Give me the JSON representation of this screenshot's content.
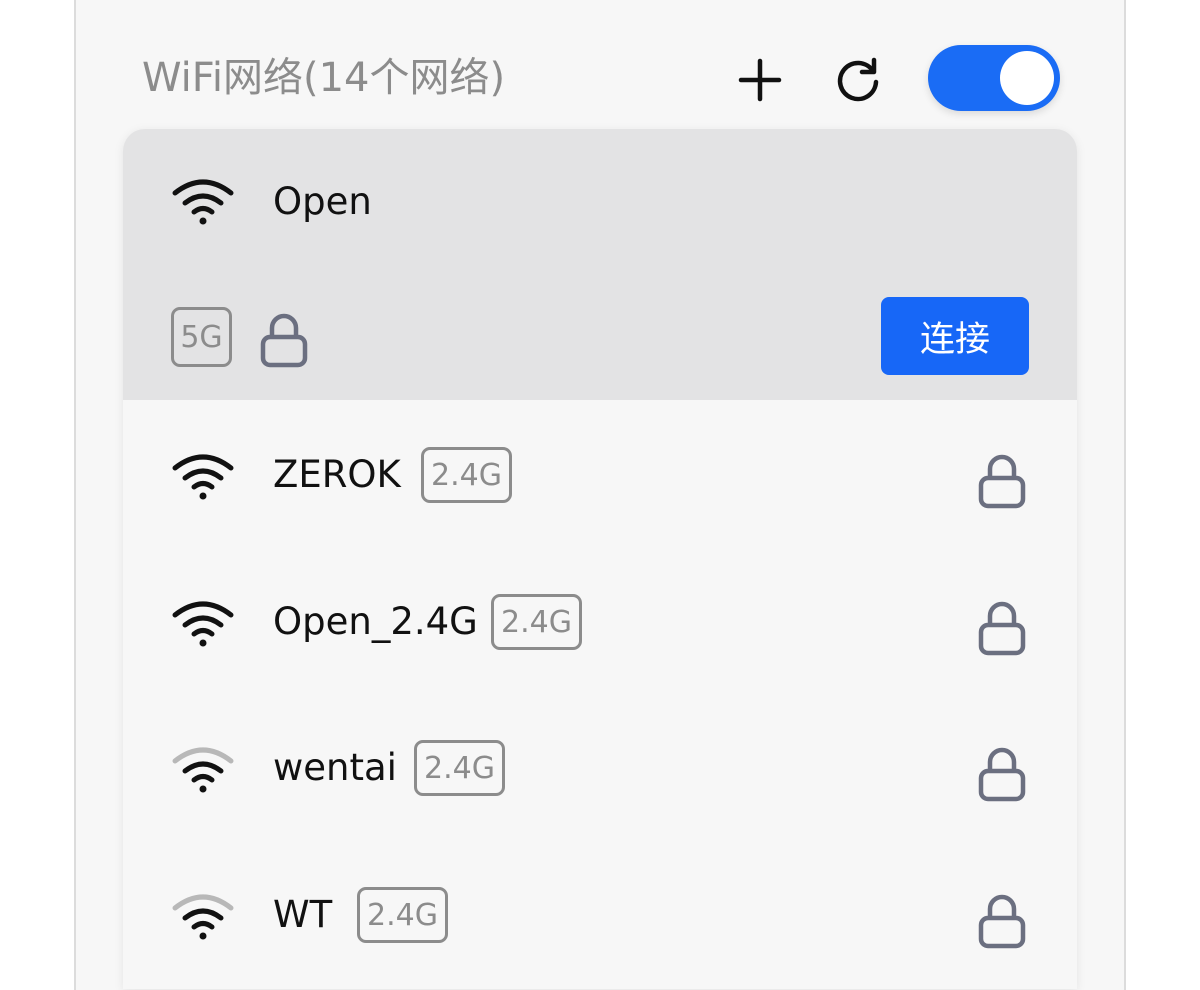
{
  "header": {
    "title": "WiFi网络(14个网络)",
    "add_icon": "plus-icon",
    "refresh_icon": "refresh-icon",
    "wifi_enabled": true
  },
  "colors": {
    "accent": "#1a6cf5",
    "selected_bg": "#e3e3e4",
    "lock": "#6b6f80",
    "muted_text": "#8c8c8c"
  },
  "selected_network": {
    "ssid": "Open",
    "band": "5G",
    "secured": true,
    "connect_label": "连接",
    "signal": "strong"
  },
  "networks": [
    {
      "ssid": "ZEROK",
      "band": "2.4G",
      "secured": true,
      "signal": "strong"
    },
    {
      "ssid": "Open_2.4G",
      "band": "2.4G",
      "secured": true,
      "signal": "strong"
    },
    {
      "ssid": "wentai",
      "band": "2.4G",
      "secured": true,
      "signal": "medium"
    },
    {
      "ssid": "WT",
      "band": "2.4G",
      "secured": true,
      "signal": "medium"
    }
  ]
}
